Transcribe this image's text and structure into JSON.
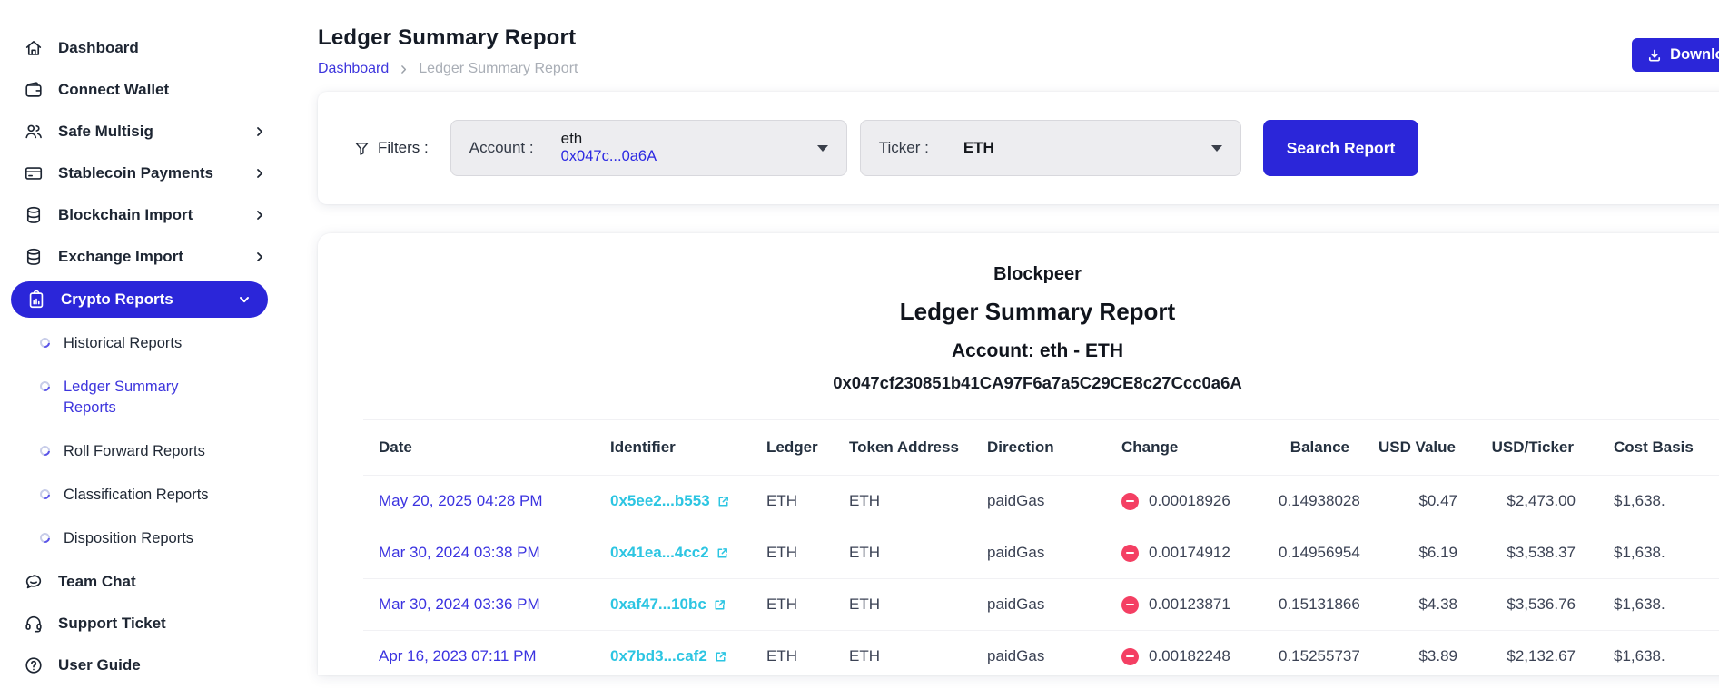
{
  "colors": {
    "primary": "#2b26d9",
    "link_indigo": "#3b33e0",
    "hash_cyan": "#2cc5e2",
    "negative_pink": "#f43f63"
  },
  "sidebar": {
    "items": [
      {
        "label": "Dashboard",
        "icon": "home-icon"
      },
      {
        "label": "Connect Wallet",
        "icon": "wallet-icon"
      },
      {
        "label": "Safe Multisig",
        "icon": "users-icon",
        "chevron": "right"
      },
      {
        "label": "Stablecoin Payments",
        "icon": "credit-card-icon",
        "chevron": "right"
      },
      {
        "label": "Blockchain Import",
        "icon": "database-icon",
        "chevron": "right"
      },
      {
        "label": "Exchange Import",
        "icon": "database-icon",
        "chevron": "right"
      },
      {
        "label": "Crypto Reports",
        "icon": "clipboard-chart-icon",
        "chevron": "down",
        "active": true
      }
    ],
    "sub_items": [
      {
        "label": "Historical Reports",
        "icon": "ring-icon"
      },
      {
        "label": "Ledger Summary Reports",
        "icon": "ring-icon",
        "active": true
      },
      {
        "label": "Roll Forward Reports",
        "icon": "ring-icon"
      },
      {
        "label": "Classification Reports",
        "icon": "ring-icon"
      },
      {
        "label": "Disposition Reports",
        "icon": "ring-icon"
      }
    ],
    "bottom_items": [
      {
        "label": "Team Chat",
        "icon": "chat-icon"
      },
      {
        "label": "Support Ticket",
        "icon": "headset-icon"
      },
      {
        "label": "User Guide",
        "icon": "question-circle-icon"
      }
    ]
  },
  "header": {
    "title": "Ledger Summary Report",
    "breadcrumb": [
      "Dashboard",
      "Ledger Summary Report"
    ],
    "download_label": "Download",
    "download_icon": "download-icon"
  },
  "filters": {
    "label": "Filters :",
    "filter_icon": "funnel-icon",
    "account_label": "Account :",
    "account_name": "eth",
    "account_address": "0x047c...0a6A",
    "ticker_label": "Ticker :",
    "ticker_value": "ETH",
    "search_label": "Search Report"
  },
  "report": {
    "brand": "Blockpeer",
    "title": "Ledger Summary Report",
    "account_line": "Account: eth - ETH",
    "address": "0x047cf230851b41CA97F6a7a5C29CE8c27Ccc0a6A"
  },
  "table": {
    "columns": [
      "Date",
      "Identifier",
      "Ledger",
      "Token Address",
      "Direction",
      "Change",
      "Balance",
      "USD Value",
      "USD/Ticker",
      "Cost Basis"
    ],
    "change_icon": "minus-circle-icon",
    "identifier_icon": "external-link-icon",
    "rows": [
      {
        "date": "May 20, 2025 04:28 PM",
        "identifier": "0x5ee2...b553",
        "ledger": "ETH",
        "token_address": "ETH",
        "direction": "paidGas",
        "change": "0.00018926",
        "balance": "0.14938028",
        "usd_value": "$0.47",
        "usd_ticker": "$2,473.00",
        "cost_basis": "$1,638."
      },
      {
        "date": "Mar 30, 2024 03:38 PM",
        "identifier": "0x41ea...4cc2",
        "ledger": "ETH",
        "token_address": "ETH",
        "direction": "paidGas",
        "change": "0.00174912",
        "balance": "0.14956954",
        "usd_value": "$6.19",
        "usd_ticker": "$3,538.37",
        "cost_basis": "$1,638."
      },
      {
        "date": "Mar 30, 2024 03:36 PM",
        "identifier": "0xaf47...10bc",
        "ledger": "ETH",
        "token_address": "ETH",
        "direction": "paidGas",
        "change": "0.00123871",
        "balance": "0.15131866",
        "usd_value": "$4.38",
        "usd_ticker": "$3,536.76",
        "cost_basis": "$1,638."
      },
      {
        "date": "Apr 16, 2023 07:11 PM",
        "identifier": "0x7bd3...caf2",
        "ledger": "ETH",
        "token_address": "ETH",
        "direction": "paidGas",
        "change": "0.00182248",
        "balance": "0.15255737",
        "usd_value": "$3.89",
        "usd_ticker": "$2,132.67",
        "cost_basis": "$1,638."
      }
    ]
  }
}
